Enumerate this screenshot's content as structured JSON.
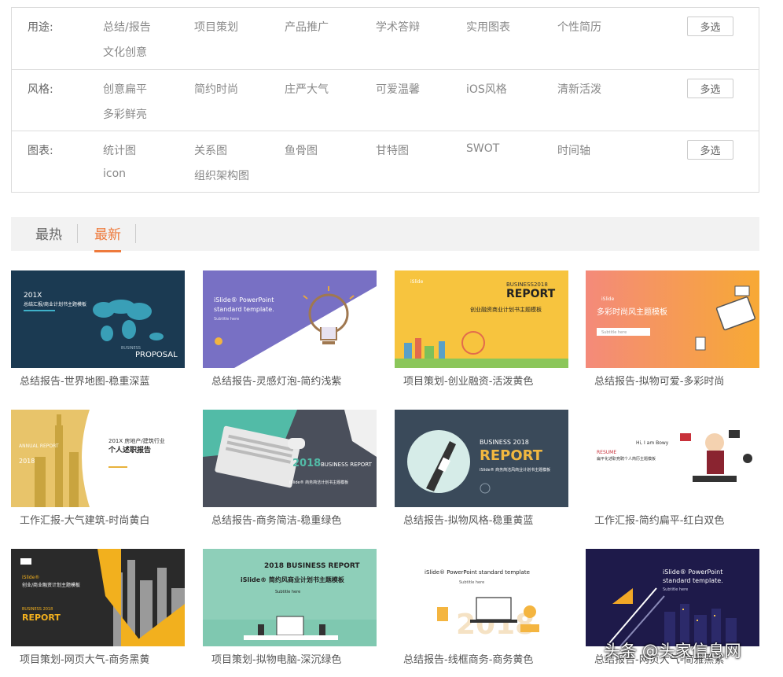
{
  "filters": [
    {
      "label": "用途:",
      "items": [
        "总结/报告",
        "项目策划",
        "产品推广",
        "学术答辩",
        "实用图表",
        "个性简历",
        "文化创意"
      ],
      "button": "多选"
    },
    {
      "label": "风格:",
      "items": [
        "创意扁平",
        "简约时尚",
        "庄严大气",
        "可爱温馨",
        "iOS风格",
        "清新活泼",
        "多彩鲜亮"
      ],
      "button": "多选"
    },
    {
      "label": "图表:",
      "items": [
        "统计图",
        "关系图",
        "鱼骨图",
        "甘特图",
        "SWOT",
        "时间轴",
        "icon",
        "组织架构图"
      ],
      "button": "多选"
    }
  ],
  "tabs": [
    {
      "label": "最热"
    },
    {
      "label": "最新"
    }
  ],
  "active_tab": "最新",
  "cards": [
    {
      "title": "总结报告-世界地图-稳重深蓝",
      "thumb": {
        "heading": "201X",
        "subheading": "总结汇报/商业计划书主题模板",
        "tag": "PROPOSAL",
        "tag2": "BUSINESS"
      }
    },
    {
      "title": "总结报告-灵感灯泡-简约浅紫",
      "thumb": {
        "heading": "iSlide® PowerPoint",
        "subheading": "standard template.",
        "tag": "Subtitle here"
      }
    },
    {
      "title": "项目策划-创业融资-活泼黄色",
      "thumb": {
        "heading": "REPORT",
        "subheading": "创业融资商业计划书主题模板",
        "tag": "BUSINESS2018",
        "brand": "iSlide"
      }
    },
    {
      "title": "总结报告-拟物可爱-多彩时尚",
      "thumb": {
        "heading": "多彩时尚风主题模板",
        "tag": "Subtitle here",
        "brand": "iSlide"
      }
    },
    {
      "title": "工作汇报-大气建筑-时尚黄白",
      "thumb": {
        "heading": "个人述职报告",
        "subheading": "201X 房地产/建筑行业",
        "tag": "2018",
        "tag2": "ANNUAL REPORT"
      }
    },
    {
      "title": "总结报告-商务简洁-稳重绿色",
      "thumb": {
        "heading": "2018",
        "subheading": "BUSINESS REPORT",
        "tag": "iSlide® 商务简洁计划书主题模板"
      }
    },
    {
      "title": "总结报告-拟物风格-稳重黄蓝",
      "thumb": {
        "heading": "REPORT",
        "subheading": "BUSINESS 2018",
        "tag": "iSlide® 商务简洁风商业计划书主题模板"
      }
    },
    {
      "title": "工作汇报-简约扁平-红白双色",
      "thumb": {
        "heading": "RESUME",
        "subheading": "Hi, I am Bowy",
        "tag": "扁平化述职竞聘个人简历主题模板"
      }
    },
    {
      "title": "项目策划-网页大气-商务黑黄",
      "thumb": {
        "heading": "iSlide®",
        "subheading": "创业/商业融资计划主题模板",
        "tag": "REPORT",
        "tag2": "BUSINESS 2018"
      }
    },
    {
      "title": "项目策划-拟物电脑-深沉绿色",
      "thumb": {
        "heading": "2018 BUSINESS REPORT",
        "subheading": "iSlide® 简约风商业计划书主题模板",
        "tag": "Subtitle here"
      }
    },
    {
      "title": "总结报告-线框商务-商务黄色",
      "thumb": {
        "heading": "iSlide® PowerPoint standard template",
        "tag": "Subtitle here"
      }
    },
    {
      "title": "总结报告-网页大气-简雅黑紫",
      "thumb": {
        "heading": "iSlide® PowerPoint",
        "subheading": "standard template.",
        "tag": "Subtitle here"
      }
    }
  ],
  "watermark": "头条 @头家信息网",
  "colors": {
    "accent": "#ee7a3c",
    "border": "#dcdcdc",
    "tab_bg": "#f2f2f2"
  }
}
